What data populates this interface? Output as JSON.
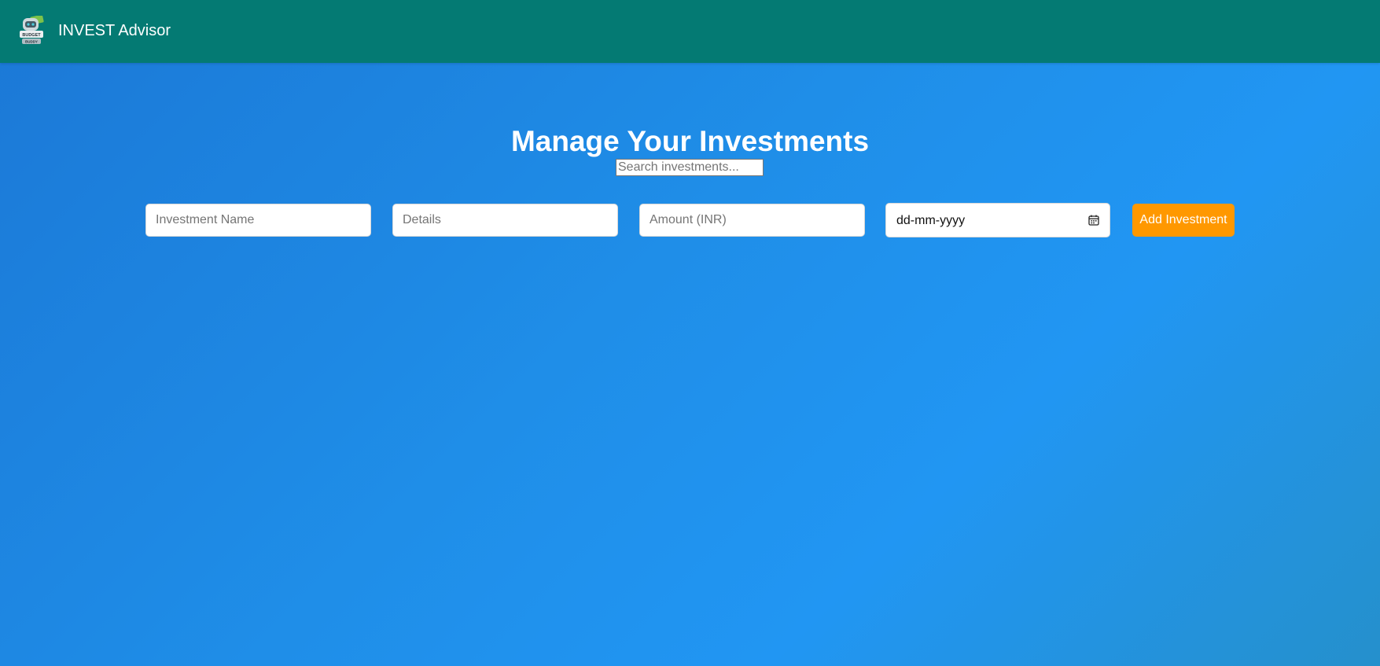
{
  "navbar": {
    "brand": "INVEST Advisor",
    "logo_icon": "budget-buddy-logo",
    "logo_text": "BUDGET BUDDY",
    "background": "#047a73"
  },
  "main": {
    "title": "Manage Your Investments",
    "search": {
      "placeholder": "Search investments...",
      "value": ""
    },
    "form": {
      "name_placeholder": "Investment Name",
      "details_placeholder": "Details",
      "amount_placeholder": "Amount (INR)",
      "date_value": "dd-mm-yyyy",
      "date_icon": "calendar-icon",
      "add_button_label": "Add Investment"
    }
  },
  "colors": {
    "accent": "#ff9800",
    "background_start": "#1b78d6",
    "background_end": "#2196f3"
  }
}
